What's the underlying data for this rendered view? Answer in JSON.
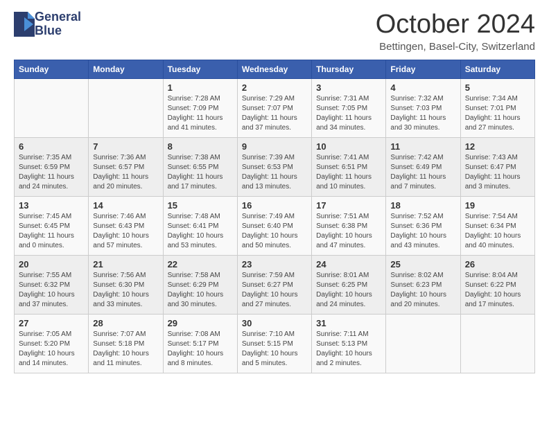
{
  "header": {
    "logo_line1": "General",
    "logo_line2": "Blue",
    "month": "October 2024",
    "location": "Bettingen, Basel-City, Switzerland"
  },
  "weekdays": [
    "Sunday",
    "Monday",
    "Tuesday",
    "Wednesday",
    "Thursday",
    "Friday",
    "Saturday"
  ],
  "weeks": [
    [
      {
        "day": "",
        "sunrise": "",
        "sunset": "",
        "daylight": ""
      },
      {
        "day": "",
        "sunrise": "",
        "sunset": "",
        "daylight": ""
      },
      {
        "day": "1",
        "sunrise": "Sunrise: 7:28 AM",
        "sunset": "Sunset: 7:09 PM",
        "daylight": "Daylight: 11 hours and 41 minutes."
      },
      {
        "day": "2",
        "sunrise": "Sunrise: 7:29 AM",
        "sunset": "Sunset: 7:07 PM",
        "daylight": "Daylight: 11 hours and 37 minutes."
      },
      {
        "day": "3",
        "sunrise": "Sunrise: 7:31 AM",
        "sunset": "Sunset: 7:05 PM",
        "daylight": "Daylight: 11 hours and 34 minutes."
      },
      {
        "day": "4",
        "sunrise": "Sunrise: 7:32 AM",
        "sunset": "Sunset: 7:03 PM",
        "daylight": "Daylight: 11 hours and 30 minutes."
      },
      {
        "day": "5",
        "sunrise": "Sunrise: 7:34 AM",
        "sunset": "Sunset: 7:01 PM",
        "daylight": "Daylight: 11 hours and 27 minutes."
      }
    ],
    [
      {
        "day": "6",
        "sunrise": "Sunrise: 7:35 AM",
        "sunset": "Sunset: 6:59 PM",
        "daylight": "Daylight: 11 hours and 24 minutes."
      },
      {
        "day": "7",
        "sunrise": "Sunrise: 7:36 AM",
        "sunset": "Sunset: 6:57 PM",
        "daylight": "Daylight: 11 hours and 20 minutes."
      },
      {
        "day": "8",
        "sunrise": "Sunrise: 7:38 AM",
        "sunset": "Sunset: 6:55 PM",
        "daylight": "Daylight: 11 hours and 17 minutes."
      },
      {
        "day": "9",
        "sunrise": "Sunrise: 7:39 AM",
        "sunset": "Sunset: 6:53 PM",
        "daylight": "Daylight: 11 hours and 13 minutes."
      },
      {
        "day": "10",
        "sunrise": "Sunrise: 7:41 AM",
        "sunset": "Sunset: 6:51 PM",
        "daylight": "Daylight: 11 hours and 10 minutes."
      },
      {
        "day": "11",
        "sunrise": "Sunrise: 7:42 AM",
        "sunset": "Sunset: 6:49 PM",
        "daylight": "Daylight: 11 hours and 7 minutes."
      },
      {
        "day": "12",
        "sunrise": "Sunrise: 7:43 AM",
        "sunset": "Sunset: 6:47 PM",
        "daylight": "Daylight: 11 hours and 3 minutes."
      }
    ],
    [
      {
        "day": "13",
        "sunrise": "Sunrise: 7:45 AM",
        "sunset": "Sunset: 6:45 PM",
        "daylight": "Daylight: 11 hours and 0 minutes."
      },
      {
        "day": "14",
        "sunrise": "Sunrise: 7:46 AM",
        "sunset": "Sunset: 6:43 PM",
        "daylight": "Daylight: 10 hours and 57 minutes."
      },
      {
        "day": "15",
        "sunrise": "Sunrise: 7:48 AM",
        "sunset": "Sunset: 6:41 PM",
        "daylight": "Daylight: 10 hours and 53 minutes."
      },
      {
        "day": "16",
        "sunrise": "Sunrise: 7:49 AM",
        "sunset": "Sunset: 6:40 PM",
        "daylight": "Daylight: 10 hours and 50 minutes."
      },
      {
        "day": "17",
        "sunrise": "Sunrise: 7:51 AM",
        "sunset": "Sunset: 6:38 PM",
        "daylight": "Daylight: 10 hours and 47 minutes."
      },
      {
        "day": "18",
        "sunrise": "Sunrise: 7:52 AM",
        "sunset": "Sunset: 6:36 PM",
        "daylight": "Daylight: 10 hours and 43 minutes."
      },
      {
        "day": "19",
        "sunrise": "Sunrise: 7:54 AM",
        "sunset": "Sunset: 6:34 PM",
        "daylight": "Daylight: 10 hours and 40 minutes."
      }
    ],
    [
      {
        "day": "20",
        "sunrise": "Sunrise: 7:55 AM",
        "sunset": "Sunset: 6:32 PM",
        "daylight": "Daylight: 10 hours and 37 minutes."
      },
      {
        "day": "21",
        "sunrise": "Sunrise: 7:56 AM",
        "sunset": "Sunset: 6:30 PM",
        "daylight": "Daylight: 10 hours and 33 minutes."
      },
      {
        "day": "22",
        "sunrise": "Sunrise: 7:58 AM",
        "sunset": "Sunset: 6:29 PM",
        "daylight": "Daylight: 10 hours and 30 minutes."
      },
      {
        "day": "23",
        "sunrise": "Sunrise: 7:59 AM",
        "sunset": "Sunset: 6:27 PM",
        "daylight": "Daylight: 10 hours and 27 minutes."
      },
      {
        "day": "24",
        "sunrise": "Sunrise: 8:01 AM",
        "sunset": "Sunset: 6:25 PM",
        "daylight": "Daylight: 10 hours and 24 minutes."
      },
      {
        "day": "25",
        "sunrise": "Sunrise: 8:02 AM",
        "sunset": "Sunset: 6:23 PM",
        "daylight": "Daylight: 10 hours and 20 minutes."
      },
      {
        "day": "26",
        "sunrise": "Sunrise: 8:04 AM",
        "sunset": "Sunset: 6:22 PM",
        "daylight": "Daylight: 10 hours and 17 minutes."
      }
    ],
    [
      {
        "day": "27",
        "sunrise": "Sunrise: 7:05 AM",
        "sunset": "Sunset: 5:20 PM",
        "daylight": "Daylight: 10 hours and 14 minutes."
      },
      {
        "day": "28",
        "sunrise": "Sunrise: 7:07 AM",
        "sunset": "Sunset: 5:18 PM",
        "daylight": "Daylight: 10 hours and 11 minutes."
      },
      {
        "day": "29",
        "sunrise": "Sunrise: 7:08 AM",
        "sunset": "Sunset: 5:17 PM",
        "daylight": "Daylight: 10 hours and 8 minutes."
      },
      {
        "day": "30",
        "sunrise": "Sunrise: 7:10 AM",
        "sunset": "Sunset: 5:15 PM",
        "daylight": "Daylight: 10 hours and 5 minutes."
      },
      {
        "day": "31",
        "sunrise": "Sunrise: 7:11 AM",
        "sunset": "Sunset: 5:13 PM",
        "daylight": "Daylight: 10 hours and 2 minutes."
      },
      {
        "day": "",
        "sunrise": "",
        "sunset": "",
        "daylight": ""
      },
      {
        "day": "",
        "sunrise": "",
        "sunset": "",
        "daylight": ""
      }
    ]
  ]
}
